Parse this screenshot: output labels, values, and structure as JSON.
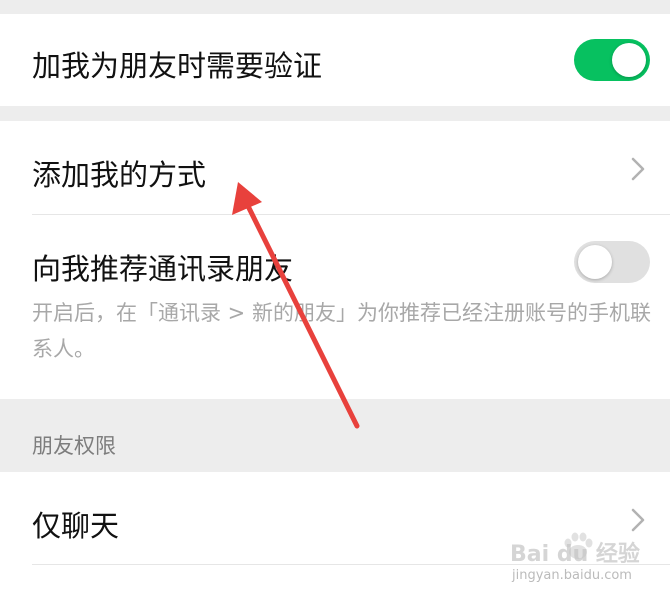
{
  "colors": {
    "accent": "#07c160",
    "toggle_off": "#e0e0e0",
    "annotation_arrow": "#e8413c"
  },
  "rows": {
    "verify": {
      "label": "加我为朋友时需要验证",
      "toggle_on": true
    },
    "add_methods": {
      "label": "添加我的方式"
    },
    "recommend": {
      "label": "向我推荐通讯录朋友",
      "toggle_on": false,
      "description": "开启后，在「通讯录 > 新的朋友」为你推荐已经注册账号的手机联系人。"
    },
    "chat_only": {
      "label": "仅聊天"
    }
  },
  "section": {
    "friends_permission": "朋友权限"
  },
  "watermark": {
    "brand": "Bai du 经验",
    "url": "jingyan.baidu.com"
  }
}
